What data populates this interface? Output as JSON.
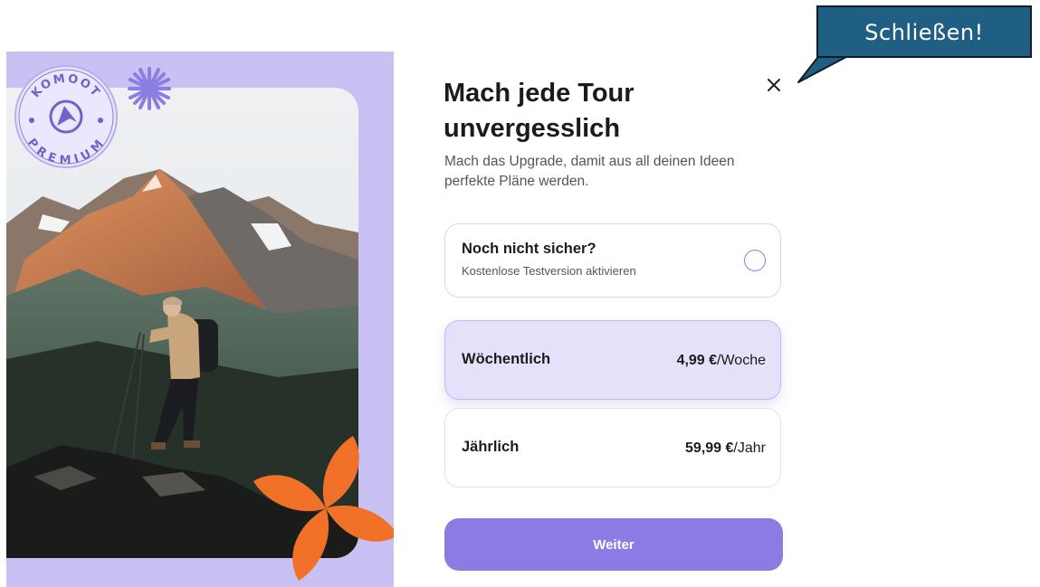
{
  "dialog": {
    "title": "Mach jede Tour unvergesslich",
    "subtitle": "Mach das Upgrade, damit aus all deinen Ideen perfekte Pläne werden.",
    "close_icon": "close-icon",
    "trial": {
      "title": "Noch nicht sicher?",
      "subtitle": "Kostenlose Testversion aktivieren",
      "selected": false
    },
    "plans": [
      {
        "name": "Wöchentlich",
        "price": "4,99 €",
        "unit": "/Woche",
        "selected": true
      },
      {
        "name": "Jährlich",
        "price": "59,99 €",
        "unit": "/Jahr",
        "selected": false
      }
    ],
    "continue_label": "Weiter"
  },
  "promo": {
    "badge_top_text": "KOMOOT",
    "badge_bottom_text": "PREMIUM",
    "photo": "hiker-on-mountain-ridge",
    "decorations": [
      "sparkle-icon",
      "flower-icon"
    ]
  },
  "annotation": {
    "callout_text": "Schließen!"
  },
  "colors": {
    "accent": "#8b7be2",
    "panel": "#c9c1f3",
    "selected_card": "#e6e1fb",
    "orange": "#f07127",
    "callout": "#1e5f83"
  }
}
